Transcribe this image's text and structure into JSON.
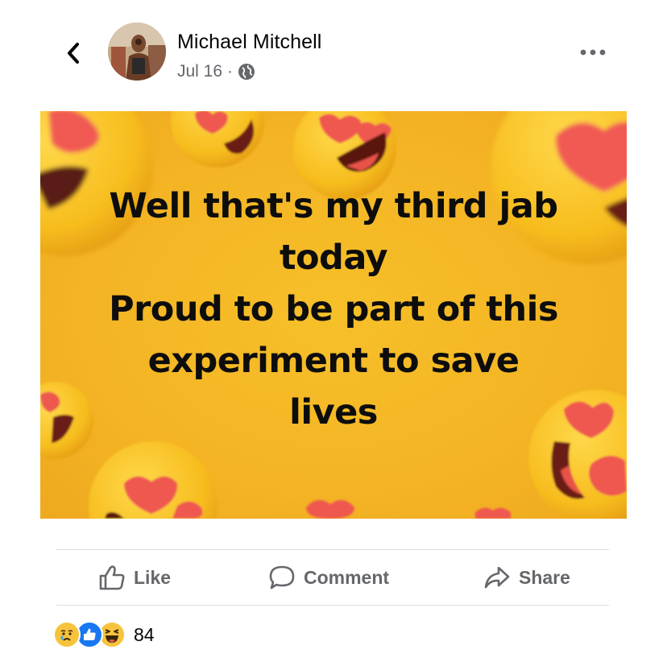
{
  "post": {
    "author_name": "Michael Mitchell",
    "date": "Jul 16",
    "separator": "·",
    "privacy_icon": "globe-icon"
  },
  "image": {
    "lines": [
      "Well that's my third jab",
      "today",
      "Proud to be part of this",
      "experiment to save",
      "lives"
    ],
    "background_color": "#f4b424",
    "text_color": "#0d0d0d"
  },
  "actions": {
    "like": "Like",
    "comment": "Comment",
    "share": "Share"
  },
  "reactions": {
    "icons": [
      "sad-reaction-icon",
      "like-reaction-icon",
      "haha-reaction-icon"
    ],
    "count": "84"
  },
  "colors": {
    "text_primary": "#050505",
    "text_secondary": "#65676b",
    "like_blue": "#1877f2",
    "reaction_yellow": "#f7c33c"
  }
}
